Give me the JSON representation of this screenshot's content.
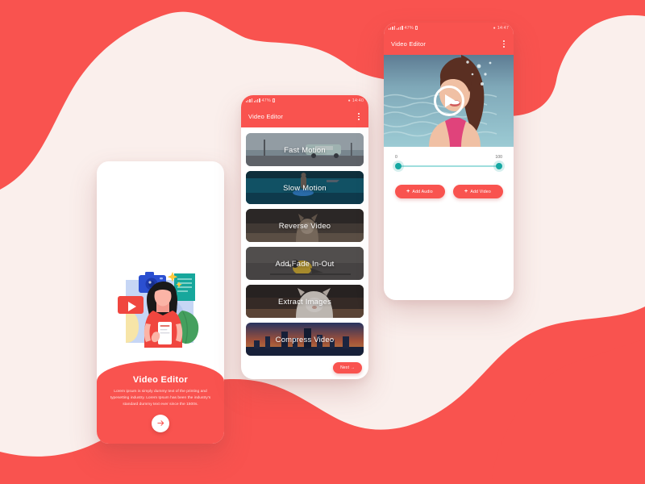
{
  "theme": {
    "brand_red": "#F9534F",
    "background_cream": "#FAEFEC",
    "teal_accent": "#16A8A2",
    "card_white": "#FFFFFF"
  },
  "status_bar": {
    "battery": "47%",
    "time_phone2": "14:40",
    "time_phone3": "14:47",
    "signal_icon": "signal-bars-icon",
    "wifi_icon": "wifi-icon",
    "battery_icon": "battery-icon"
  },
  "onboarding": {
    "title": "Video Editor",
    "description": "Lorem ipsum is simply dummy text of the printing and typesetting industry. Lorem Ipsum has been the industry's standard dummy text ever since the 1500s.",
    "next_icon": "arrow-right-icon"
  },
  "feature_list": {
    "appbar_title": "Video Editor",
    "menu_icon": "kebab-menu-icon",
    "items": [
      {
        "label": "Fast Motion",
        "thumb": "beach-van"
      },
      {
        "label": "Slow Motion",
        "thumb": "sea-surfer"
      },
      {
        "label": "Reverse Video",
        "thumb": "dog-field"
      },
      {
        "label": "Add Fade In-Out",
        "thumb": "bird-branch"
      },
      {
        "label": "Extract Images",
        "thumb": "cat-closeup"
      },
      {
        "label": "Compress Video",
        "thumb": "city-sunset"
      }
    ],
    "next_label": "Next  →"
  },
  "editor": {
    "appbar_title": "Video Editor",
    "menu_icon": "kebab-menu-icon",
    "play_icon": "play-button-icon",
    "video_thumb": "underwater-swimmer",
    "trim_slider": {
      "min_label": "0",
      "max_label": "100",
      "min_value": 0,
      "max_value": 100
    },
    "buttons": [
      {
        "label": "Add Audio",
        "icon": "plus-icon"
      },
      {
        "label": "Add Video",
        "icon": "plus-icon"
      }
    ]
  }
}
